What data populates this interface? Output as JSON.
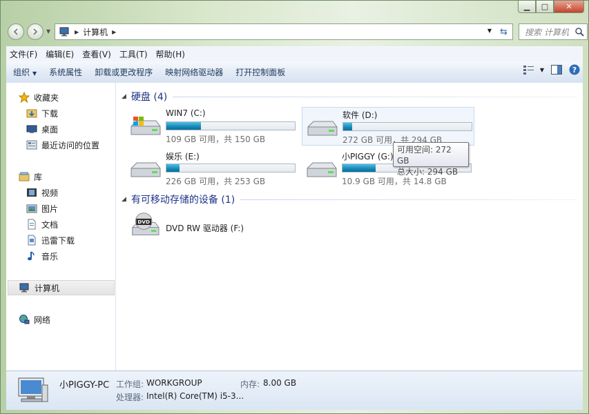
{
  "window": {
    "caption": {
      "minimize": "▁",
      "maximize": "□",
      "close": "✕"
    }
  },
  "nav": {
    "back_icon": "back-arrow-icon",
    "forward_icon": "forward-arrow-icon",
    "address_crumb": "计算机",
    "search_placeholder": "搜索 计算机"
  },
  "menu": [
    "文件(F)",
    "编辑(E)",
    "查看(V)",
    "工具(T)",
    "帮助(H)"
  ],
  "toolbar": {
    "organize": "组织",
    "items": [
      "系统属性",
      "卸载或更改程序",
      "映射网络驱动器",
      "打开控制面板"
    ]
  },
  "sidebar": {
    "favorites": {
      "label": "收藏夹",
      "items": [
        "下载",
        "桌面",
        "最近访问的位置"
      ]
    },
    "libraries": {
      "label": "库",
      "items": [
        "视频",
        "图片",
        "文档",
        "迅雷下载",
        "音乐"
      ]
    },
    "computer": "计算机",
    "network": "网络"
  },
  "groups": {
    "hard_disks": {
      "header": "硬盘 (4)",
      "drives": [
        {
          "name": "WIN7 (C:)",
          "info": "109 GB 可用，共 150 GB",
          "used_fraction": 0.27,
          "icon": "windows-drive-icon"
        },
        {
          "name": "软件 (D:)",
          "info": "272 GB 可用，共 294 GB",
          "used_fraction": 0.07,
          "icon": "hard-drive-icon"
        },
        {
          "name": "娱乐 (E:)",
          "info": "226 GB 可用，共 253 GB",
          "used_fraction": 0.1,
          "icon": "hard-drive-icon"
        },
        {
          "name": "小PIGGY (G:)",
          "info": "10.9 GB 可用，共 14.8 GB",
          "used_fraction": 0.26,
          "icon": "hard-drive-icon"
        }
      ]
    },
    "removable": {
      "header": "有可移动存储的设备 (1)",
      "drives": [
        {
          "name": "DVD RW 驱动器 (F:)",
          "icon": "dvd-drive-icon"
        }
      ]
    }
  },
  "tooltip": {
    "line1": "可用空间: 272 GB",
    "line2": "总大小: 294 GB"
  },
  "details": {
    "pc_name": "小PIGGY-PC",
    "workgroup_label": "工作组:",
    "workgroup": "WORKGROUP",
    "memory_label": "内存:",
    "memory": "8.00 GB",
    "processor_label": "处理器:",
    "processor": "Intel(R) Core(TM) i5-3..."
  },
  "colors": {
    "accent": "#1e3287",
    "bar_fill": "#1787b7"
  }
}
